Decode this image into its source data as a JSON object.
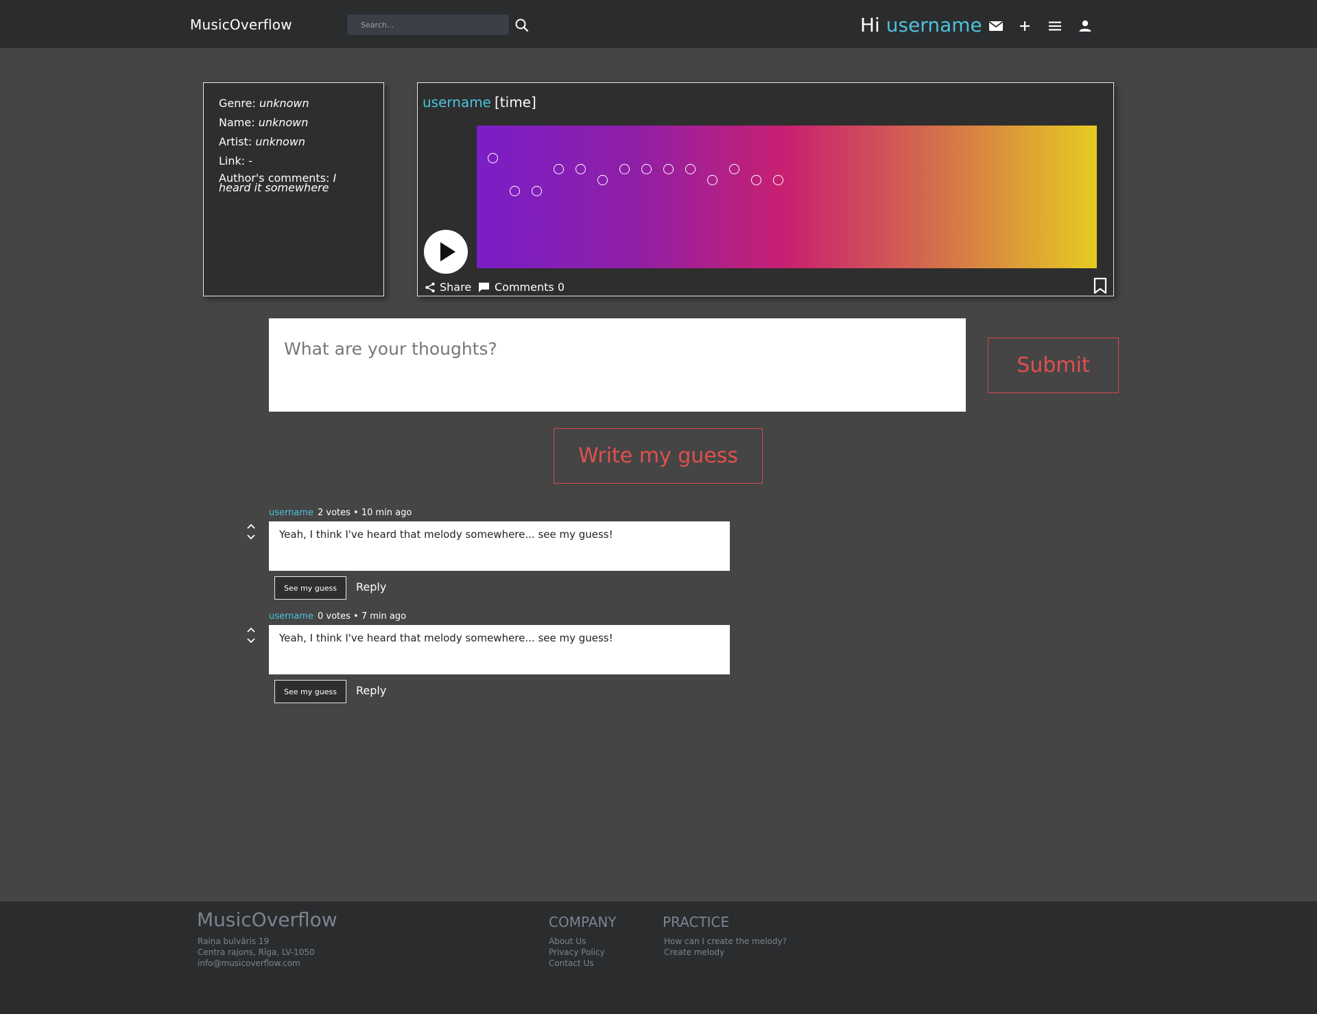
{
  "header": {
    "brand": "MusicOverflow",
    "search_placeholder": "Search...",
    "greeting": "Hi",
    "username": "username"
  },
  "info": {
    "genre_label": "Genre:",
    "genre_value": "unknown",
    "name_label": "Name:",
    "name_value": "unknown",
    "artist_label": "Artist:",
    "artist_value": "unknown",
    "link_label": "Link:",
    "link_value": "-",
    "comments_label": "Author's comments:",
    "comments_value": "I heard it somewhere"
  },
  "melody": {
    "username": "username",
    "time": "[time]",
    "share_label": "Share",
    "comments_label": "Comments 0",
    "gradient_colors": [
      "#7a1ec6",
      "#c92070",
      "#e6cb22"
    ]
  },
  "comment_form": {
    "placeholder": "What are your thoughts?",
    "submit_label": "Submit",
    "guess_label": "Write my guess"
  },
  "comments": [
    {
      "username": "username",
      "meta": "2 votes • 10 min ago",
      "text": "Yeah, I think I've heard that melody somewhere... see my guess!",
      "see_label": "See my guess",
      "reply_label": "Reply"
    },
    {
      "username": "username",
      "meta": "0 votes • 7 min ago",
      "text": "Yeah, I think I've heard that melody somewhere... see my guess!",
      "see_label": "See my guess",
      "reply_label": "Reply"
    }
  ],
  "footer": {
    "brand": "MusicOverflow",
    "address_line1": "Raiņa bulvāris 19",
    "address_line2": "Centra rajons, Rīga, LV-1050",
    "email": "info@musicoverflow.com",
    "company_heading": "COMPANY",
    "company_links": [
      "About Us",
      "Privacy Policy",
      "Contact Us"
    ],
    "practice_heading": "PRACTICE",
    "practice_links": [
      "How can I create the melody?",
      "Create melody"
    ]
  },
  "colors": {
    "accent": "#4cc3dd",
    "button_red": "#e0504d",
    "background": "#454545",
    "header_bg": "#2b2c2e"
  }
}
